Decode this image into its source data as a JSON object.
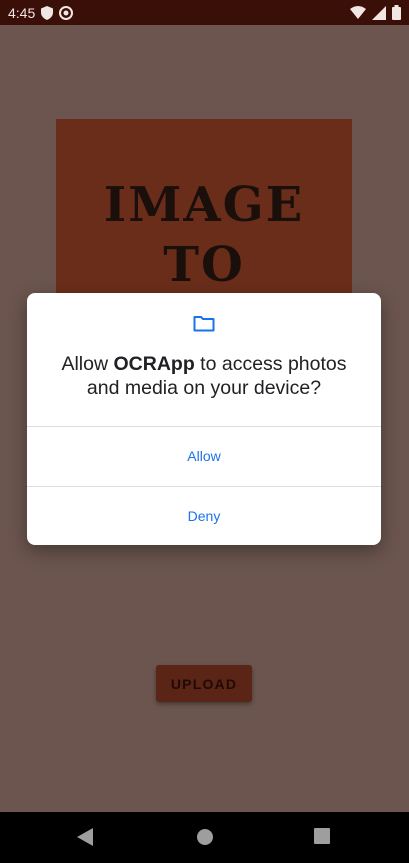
{
  "status_bar": {
    "time": "4:45",
    "icons": [
      "shield-icon",
      "vpn-icon",
      "wifi-icon",
      "signal-icon",
      "battery-icon"
    ]
  },
  "hero": {
    "line1": "IMAGE",
    "line2": "TO"
  },
  "upload_button": {
    "label": "UPLOAD"
  },
  "dialog": {
    "icon": "folder-icon",
    "message_prefix": "Allow ",
    "app_name": "OCRApp",
    "message_suffix": " to access photos and media on your device?",
    "allow_label": "Allow",
    "deny_label": "Deny"
  },
  "nav_bar": {
    "icons": [
      "back-icon",
      "home-icon",
      "recents-icon"
    ]
  },
  "colors": {
    "status_bar": "#3a0f08",
    "background": "#6b554e",
    "hero": "#6a2d1a",
    "accent": "#1a73e8"
  }
}
